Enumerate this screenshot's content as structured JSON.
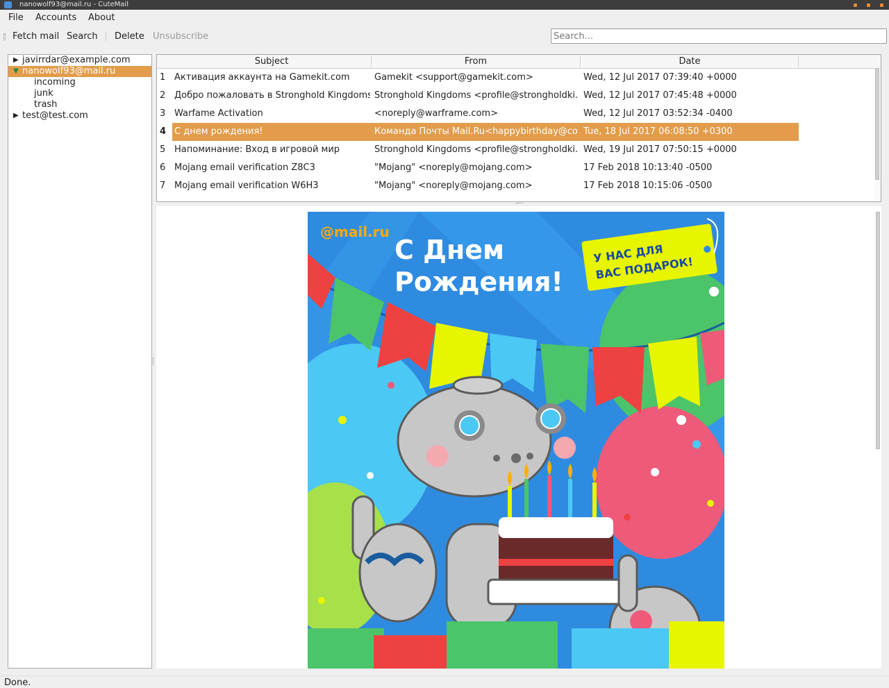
{
  "window": {
    "title": "nanowolf93@mail.ru - CuteMail"
  },
  "menu": {
    "file": "File",
    "accounts": "Accounts",
    "about": "About"
  },
  "toolbar": {
    "fetch": "Fetch mail",
    "search": "Search",
    "delete": "Delete",
    "unsubscribe": "Unsubscribe",
    "search_placeholder": "Search..."
  },
  "accounts": [
    {
      "label": "javirrdar@example.com",
      "expanded": false
    },
    {
      "label": "nanowolf93@mail.ru",
      "expanded": true,
      "folders": [
        "incoming",
        "junk",
        "trash"
      ]
    },
    {
      "label": "test@test.com",
      "expanded": false
    }
  ],
  "messages": {
    "headers": {
      "subject": "Subject",
      "from": "From",
      "date": "Date"
    },
    "rows": [
      {
        "num": "1",
        "subject": "Активация аккаунта на Gamekit.com",
        "from": "Gamekit <support@gamekit.com>",
        "date": "Wed, 12 Jul 2017 07:39:40 +0000"
      },
      {
        "num": "2",
        "subject": "Добро пожаловать в Stronghold Kingdoms",
        "from": "Stronghold Kingdoms <profile@strongholdki...",
        "date": "Wed, 12 Jul 2017 07:45:48 +0000"
      },
      {
        "num": "3",
        "subject": "Warfame Activation",
        "from": "<noreply@warframe.com>",
        "date": "Wed, 12 Jul 2017 03:52:34 -0400"
      },
      {
        "num": "4",
        "subject": "С днем рождения!",
        "from": "Команда Почты Mail.Ru<happybirthday@co...",
        "date": "Tue, 18 Jul 2017 06:08:50 +0300"
      },
      {
        "num": "5",
        "subject": "Напоминание: Вход в игровой мир",
        "from": "Stronghold Kingdoms <profile@strongholdki...",
        "date": "Wed, 19 Jul 2017 07:50:15 +0000"
      },
      {
        "num": "6",
        "subject": "Mojang email verification Z8C3",
        "from": "\"Mojang\" <noreply@mojang.com>",
        "date": "17 Feb 2018 10:13:40 -0500"
      },
      {
        "num": "7",
        "subject": "Mojang email verification W6H3",
        "from": "\"Mojang\" <noreply@mojang.com>",
        "date": "17 Feb 2018 10:15:06 -0500"
      }
    ]
  },
  "preview": {
    "logo": "@mail.ru",
    "headline_line1": "С Днем",
    "headline_line2": "Рождения!",
    "tag_line1": "У НАС ДЛЯ",
    "tag_line2": "ВАС ПОДАРОК!"
  },
  "status": "Done.",
  "colors": {
    "selection": "#e29c4b",
    "card_bg": "#2f8be0",
    "tag": "#e8f500"
  }
}
